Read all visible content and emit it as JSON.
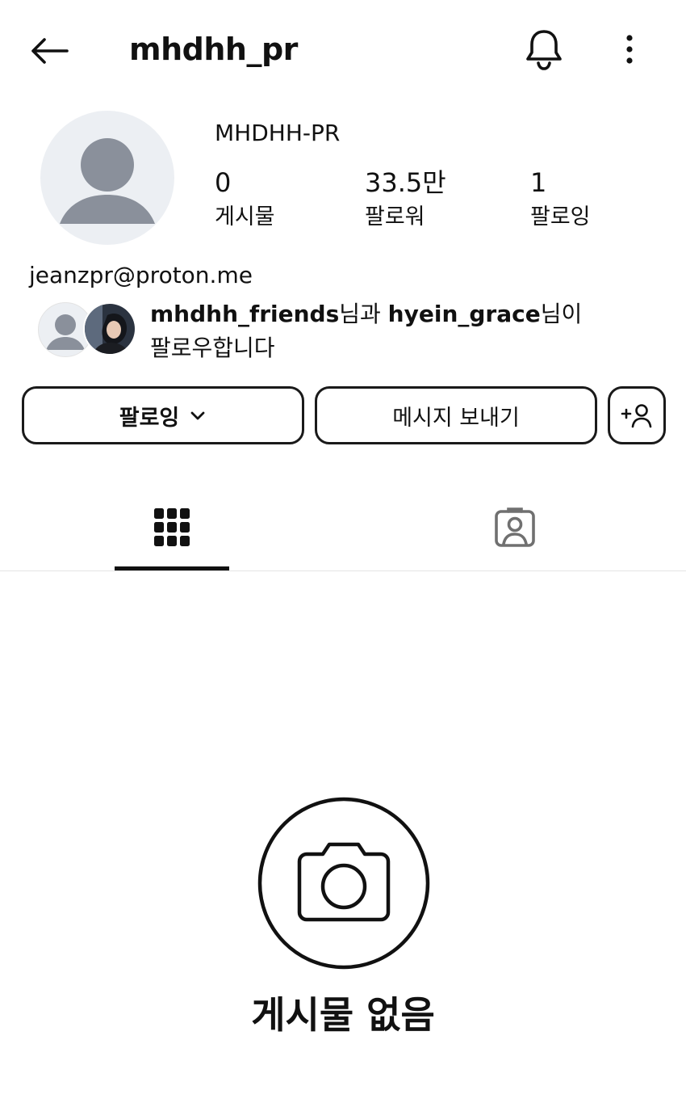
{
  "header": {
    "username": "mhdhh_pr",
    "icons": {
      "back": "arrow-left-icon",
      "notifications": "bell-icon",
      "more": "more-vertical-icon"
    }
  },
  "profile": {
    "full_name": "MHDHH-PR",
    "stats": [
      {
        "value": "0",
        "label": "게시물"
      },
      {
        "value": "33.5만",
        "label": "팔로워"
      },
      {
        "value": "1",
        "label": "팔로잉"
      }
    ],
    "bio_link": "jeanzpr@proton.me"
  },
  "mutual": {
    "user1": "mhdhh_friends",
    "joiner": "님과 ",
    "user2": "hyein_grace",
    "suffix1": "님이",
    "line2": "팔로우합니다"
  },
  "actions": {
    "following_label": "팔로잉",
    "message_label": "메시지 보내기",
    "suggest_icon": "add-person-icon"
  },
  "tabs": [
    {
      "name": "posts",
      "icon": "grid-icon",
      "selected": true
    },
    {
      "name": "tagged",
      "icon": "tagged-person-icon",
      "selected": false
    }
  ],
  "empty_state": {
    "icon": "camera-icon",
    "title": "게시물 없음"
  },
  "colors": {
    "text": "#111111",
    "placeholder_bg": "#eceff3",
    "placeholder_fg": "#8a909b",
    "border": "#1a1a1a"
  }
}
